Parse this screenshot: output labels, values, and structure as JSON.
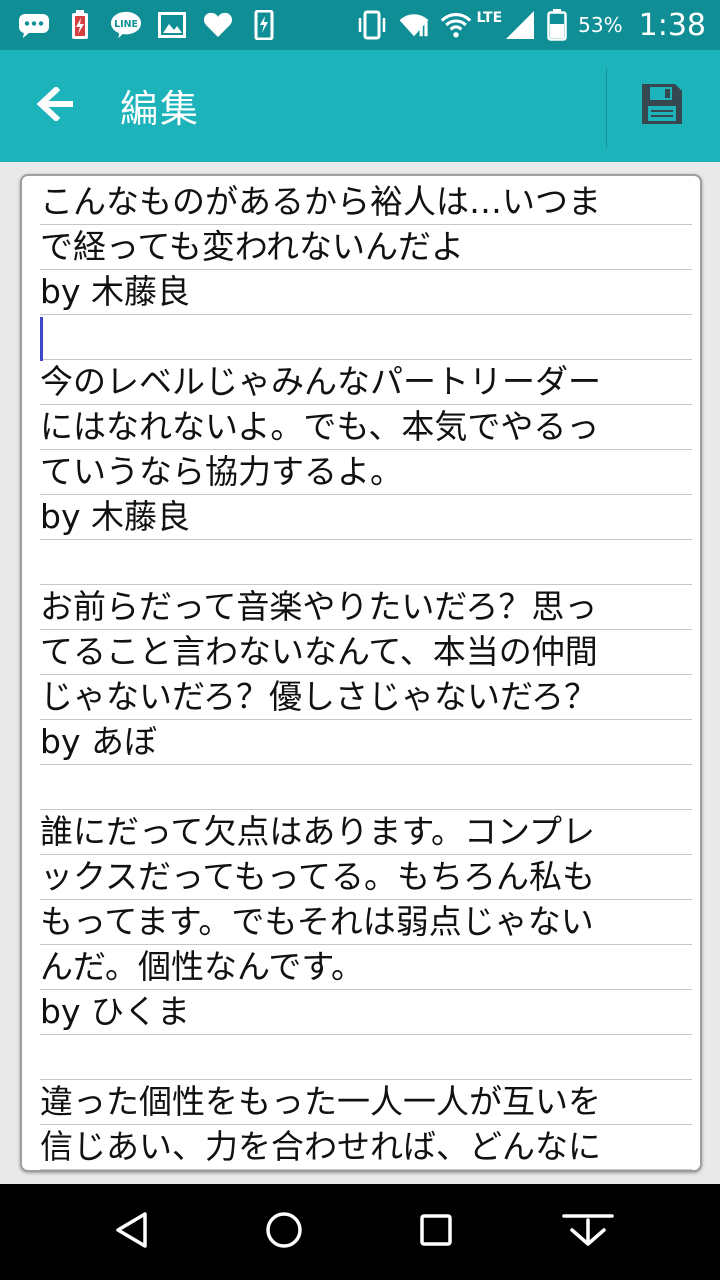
{
  "status_bar": {
    "battery_percent": "53%",
    "time": "1:38",
    "network": "LTE",
    "icons": [
      "chat-bubble-icon",
      "battery-alert-icon",
      "line-app-icon",
      "image-icon",
      "heart-icon",
      "phone-charge-icon",
      "vibrate-icon",
      "wifi-icon",
      "wifi-icon",
      "signal-icon",
      "battery-icon"
    ]
  },
  "appbar": {
    "title": "編集",
    "back_icon": "arrow-left-icon",
    "save_icon": "save-icon",
    "color": "#1cb3ba"
  },
  "editor": {
    "lines": [
      "こんなものがあるから裕人は…いつま",
      "で経っても変われないんだよ",
      "by 木藤良",
      "",
      "今のレベルじゃみんなパートリーダー",
      "にはなれないよ。でも、本気でやるっ",
      "ていうなら協力するよ。",
      "by 木藤良",
      "",
      "お前らだって音楽やりたいだろ？思っ",
      "てること言わないなんて、本当の仲間",
      "じゃないだろ？優しさじゃないだろ？",
      "by あぼ",
      "",
      "誰にだって欠点はあります。コンプレ",
      "ックスだってもってる。もちろん私も",
      "もってます。でもそれは弱点じゃない",
      "んだ。個性なんです。",
      "by ひくま",
      "",
      "違った個性をもった一人一人が互いを",
      "信じあい、力を合わせれば、どんなに"
    ]
  },
  "nav_bar": {
    "buttons": [
      "back-triangle-icon",
      "home-circle-icon",
      "recents-square-icon",
      "hide-keyboard-icon"
    ]
  }
}
